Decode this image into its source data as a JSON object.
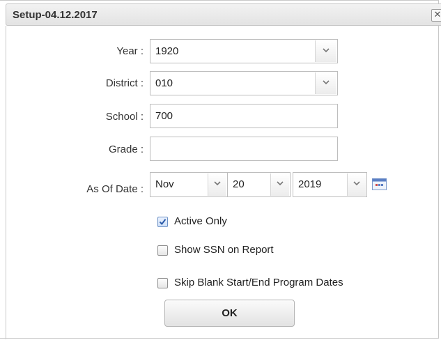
{
  "dialog": {
    "title": "Setup-04.12.2017",
    "close_glyph": "✕"
  },
  "form": {
    "year": {
      "label": "Year :",
      "value": "1920"
    },
    "district": {
      "label": "District :",
      "value": "010"
    },
    "school": {
      "label": "School :",
      "value": "700"
    },
    "grade": {
      "label": "Grade :",
      "value": ""
    },
    "as_of_date": {
      "label": "As Of Date :",
      "month": "Nov",
      "day": "20",
      "year": "2019"
    }
  },
  "options": [
    {
      "label": "Active Only",
      "checked": true
    },
    {
      "label": "Show SSN on Report",
      "checked": false
    },
    {
      "label": "Skip Blank Start/End Program Dates",
      "checked": false
    }
  ],
  "ok_label": "OK",
  "icons": {
    "dropdown": "chevron-down-icon",
    "calendar": "calendar-icon",
    "close": "close-icon",
    "checkbox_checked": "checkmark-icon"
  },
  "colors": {
    "checkmark": "#2a5aa8",
    "calendar_accent": "#5b7fc4"
  }
}
